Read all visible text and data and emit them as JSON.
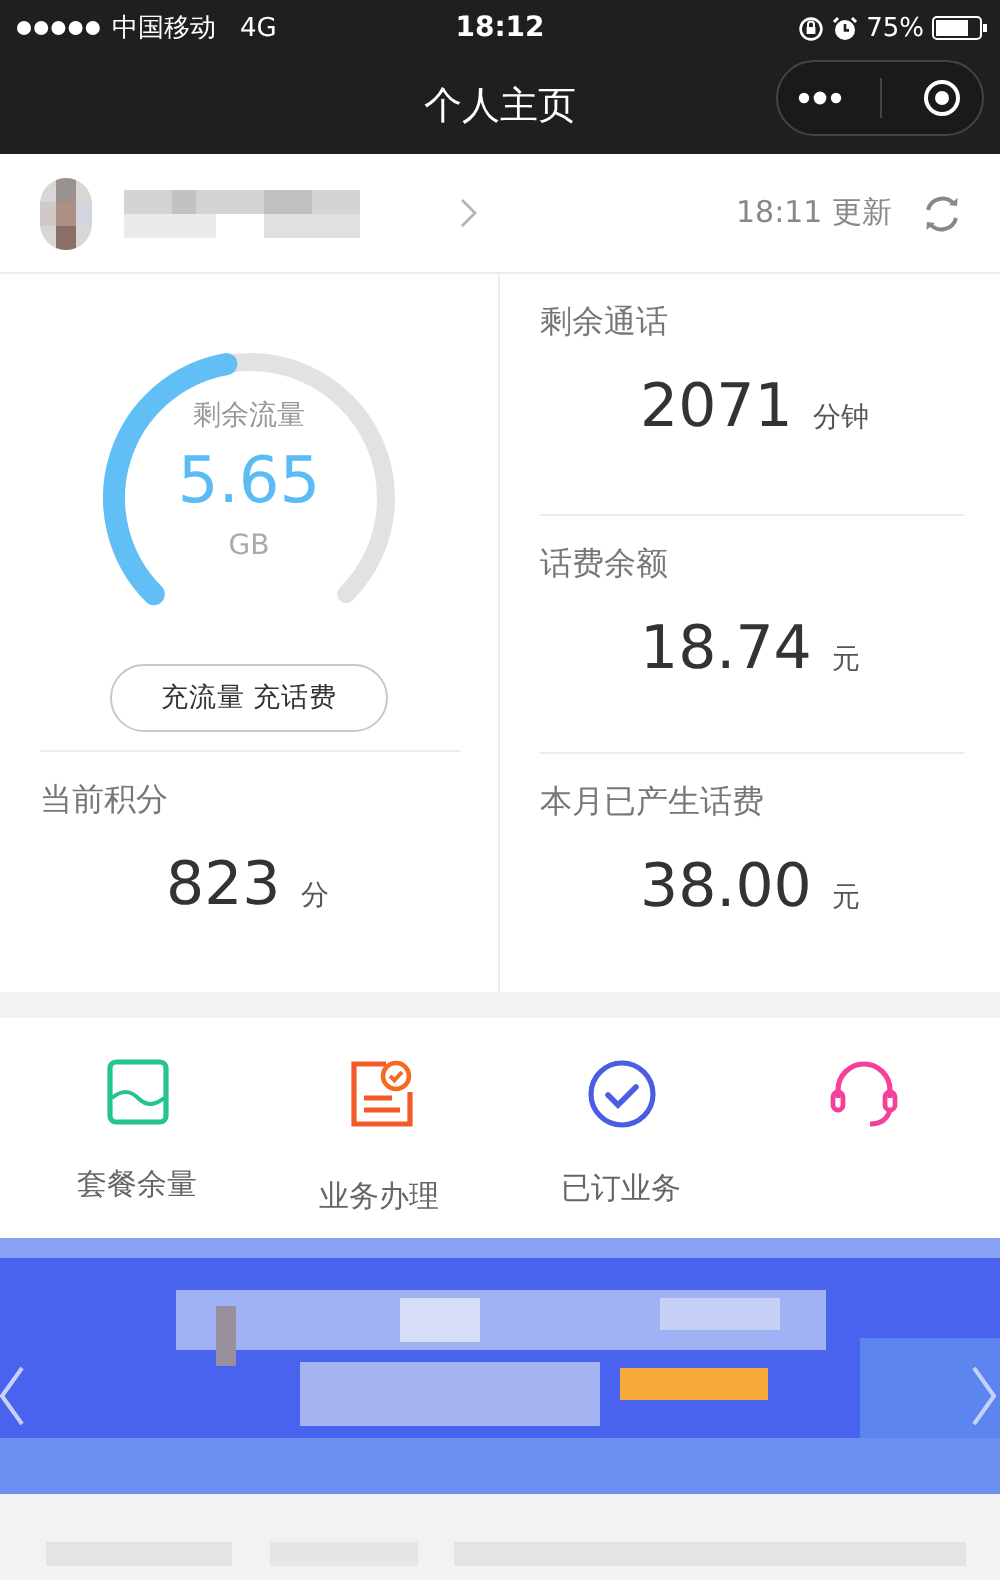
{
  "status_bar": {
    "carrier": "中国移动",
    "network": "4G",
    "time": "18:12",
    "battery": "75%"
  },
  "nav": {
    "title": "个人主页"
  },
  "account": {
    "updated": "18:11 更新"
  },
  "data_gauge": {
    "label": "剩余流量",
    "value": "5.65",
    "unit": "GB",
    "button": "充流量 充话费"
  },
  "points": {
    "label": "当前积分",
    "value": "823",
    "unit": "分"
  },
  "stats": [
    {
      "label": "剩余通话",
      "value": "2071",
      "unit": "分钟"
    },
    {
      "label": "话费余额",
      "value": "18.74",
      "unit": "元"
    },
    {
      "label": "本月已产生话费",
      "value": "38.00",
      "unit": "元"
    }
  ],
  "shortcuts": [
    {
      "kind": "package",
      "label": "套餐余量"
    },
    {
      "kind": "handle",
      "label": "业务办理"
    },
    {
      "kind": "subscribed",
      "label": "已订业务"
    },
    {
      "kind": "service"
    }
  ]
}
